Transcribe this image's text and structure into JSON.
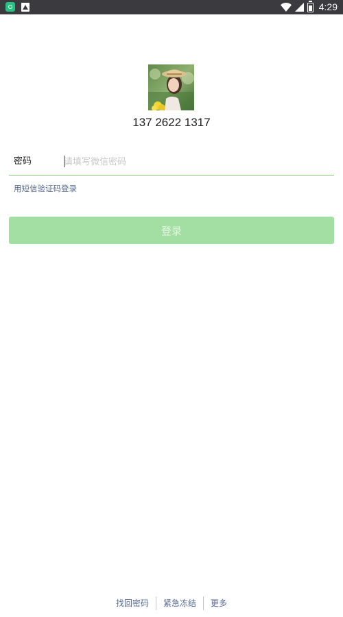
{
  "status_bar": {
    "time": "4:29",
    "left_icons": [
      "app-notification-icon",
      "picture-notification-icon"
    ],
    "right_icons": [
      "wifi-icon",
      "cell-signal-icon",
      "battery-charging-icon"
    ]
  },
  "account": {
    "avatar": "profile-photo",
    "number": "137 2622 1317"
  },
  "password": {
    "label": "密码",
    "placeholder": "请填写微信密码",
    "value": ""
  },
  "sms_login": {
    "label": "用短信验证码登录"
  },
  "login_button": {
    "label": "登录",
    "color": "#a3dfa3"
  },
  "footer": {
    "links": [
      "找回密码",
      "紧急冻结",
      "更多"
    ]
  },
  "colors": {
    "status_bar_bg": "#3a3a3f",
    "accent_green": "#7cc771",
    "link_blue": "#576b95"
  }
}
